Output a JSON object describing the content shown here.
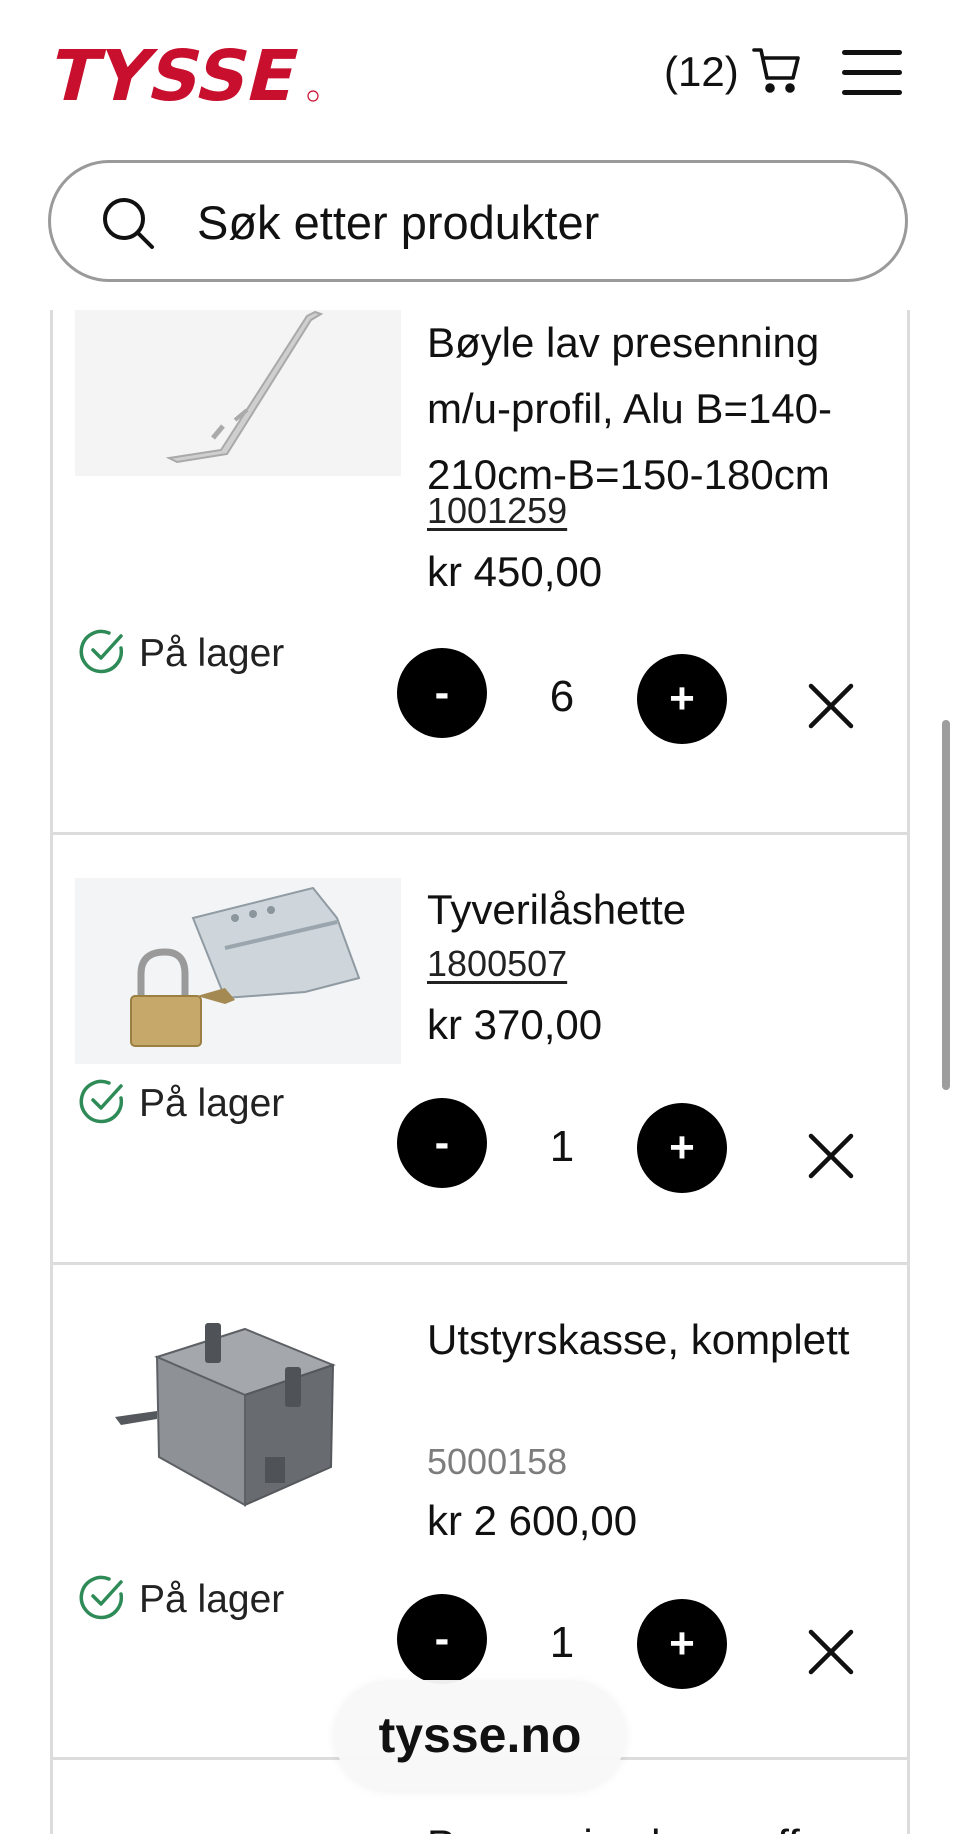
{
  "header": {
    "logo_text": "TYSSE",
    "logo_color": "#c8102e",
    "cart_count": "(12)",
    "cart_icon": "cart-icon",
    "menu_icon": "hamburger-menu-icon"
  },
  "search": {
    "placeholder": "Søk etter produkter",
    "icon": "search-icon"
  },
  "cart_items": [
    {
      "name": "Bøyle lav presenning m/u-profil, Alu B=140-210cm-B=150-180cm",
      "sku": "1001259",
      "price": "kr 450,00",
      "stock": "På lager",
      "quantity": "6",
      "minus_label": "-",
      "plus_label": "+"
    },
    {
      "name": "Tyverilåshette",
      "sku": "1800507",
      "price": "kr 370,00",
      "stock": "På lager",
      "quantity": "1",
      "minus_label": "-",
      "plus_label": "+"
    },
    {
      "name": "Utstyrskasse, komplett",
      "sku": "5000158",
      "price": "kr 2 600,00",
      "stock": "På lager",
      "quantity": "1",
      "minus_label": "-",
      "plus_label": "+"
    },
    {
      "name": "Presenning lav proff"
    }
  ],
  "colors": {
    "in_stock": "#2e8b57",
    "border": "#dcdcdc"
  },
  "footer": {
    "domain": "tysse.no"
  }
}
